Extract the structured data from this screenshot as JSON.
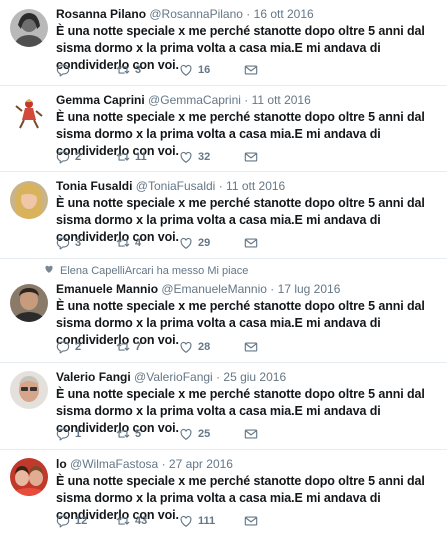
{
  "tweet_text": "È una notte speciale x me perché stanotte dopo oltre 5 anni dal sisma dormo x la prima volta a casa mia.E mi andava di condividerlo con voi.",
  "separator": "·",
  "tweets": [
    {
      "name": "Rosanna Pilano",
      "handle": "@RosannaPilano",
      "date": "16 ott 2016",
      "context": "",
      "replies": "",
      "retweets": "3",
      "likes": "16"
    },
    {
      "name": "Gemma Caprini",
      "handle": "@GemmaCaprini",
      "date": "11 ott 2016",
      "context": "",
      "replies": "2",
      "retweets": "11",
      "likes": "32"
    },
    {
      "name": "Tonia Fusaldi",
      "handle": "@ToniaFusaldi",
      "date": "11 ott 2016",
      "context": "",
      "replies": "3",
      "retweets": "4",
      "likes": "29"
    },
    {
      "name": "Emanuele Mannio",
      "handle": "@EmanueleMannio",
      "date": "17 lug 2016",
      "context": "Elena CapelliArcari ha messo Mi piace",
      "replies": "2",
      "retweets": "7",
      "likes": "28"
    },
    {
      "name": "Valerio Fangi",
      "handle": "@ValerioFangi",
      "date": "25 giu 2016",
      "context": "",
      "replies": "1",
      "retweets": "5",
      "likes": "25"
    },
    {
      "name": "lo",
      "handle": "@WilmaFastosa",
      "date": "27 apr 2016",
      "context": "",
      "replies": "12",
      "retweets": "43",
      "likes": "111"
    }
  ],
  "colors": {
    "text": "#14171a",
    "secondary": "#657786",
    "divider": "#e6ecf0"
  },
  "icons": {
    "reply": "reply-icon",
    "retweet": "retweet-icon",
    "like": "heart-icon",
    "message": "envelope-icon"
  }
}
